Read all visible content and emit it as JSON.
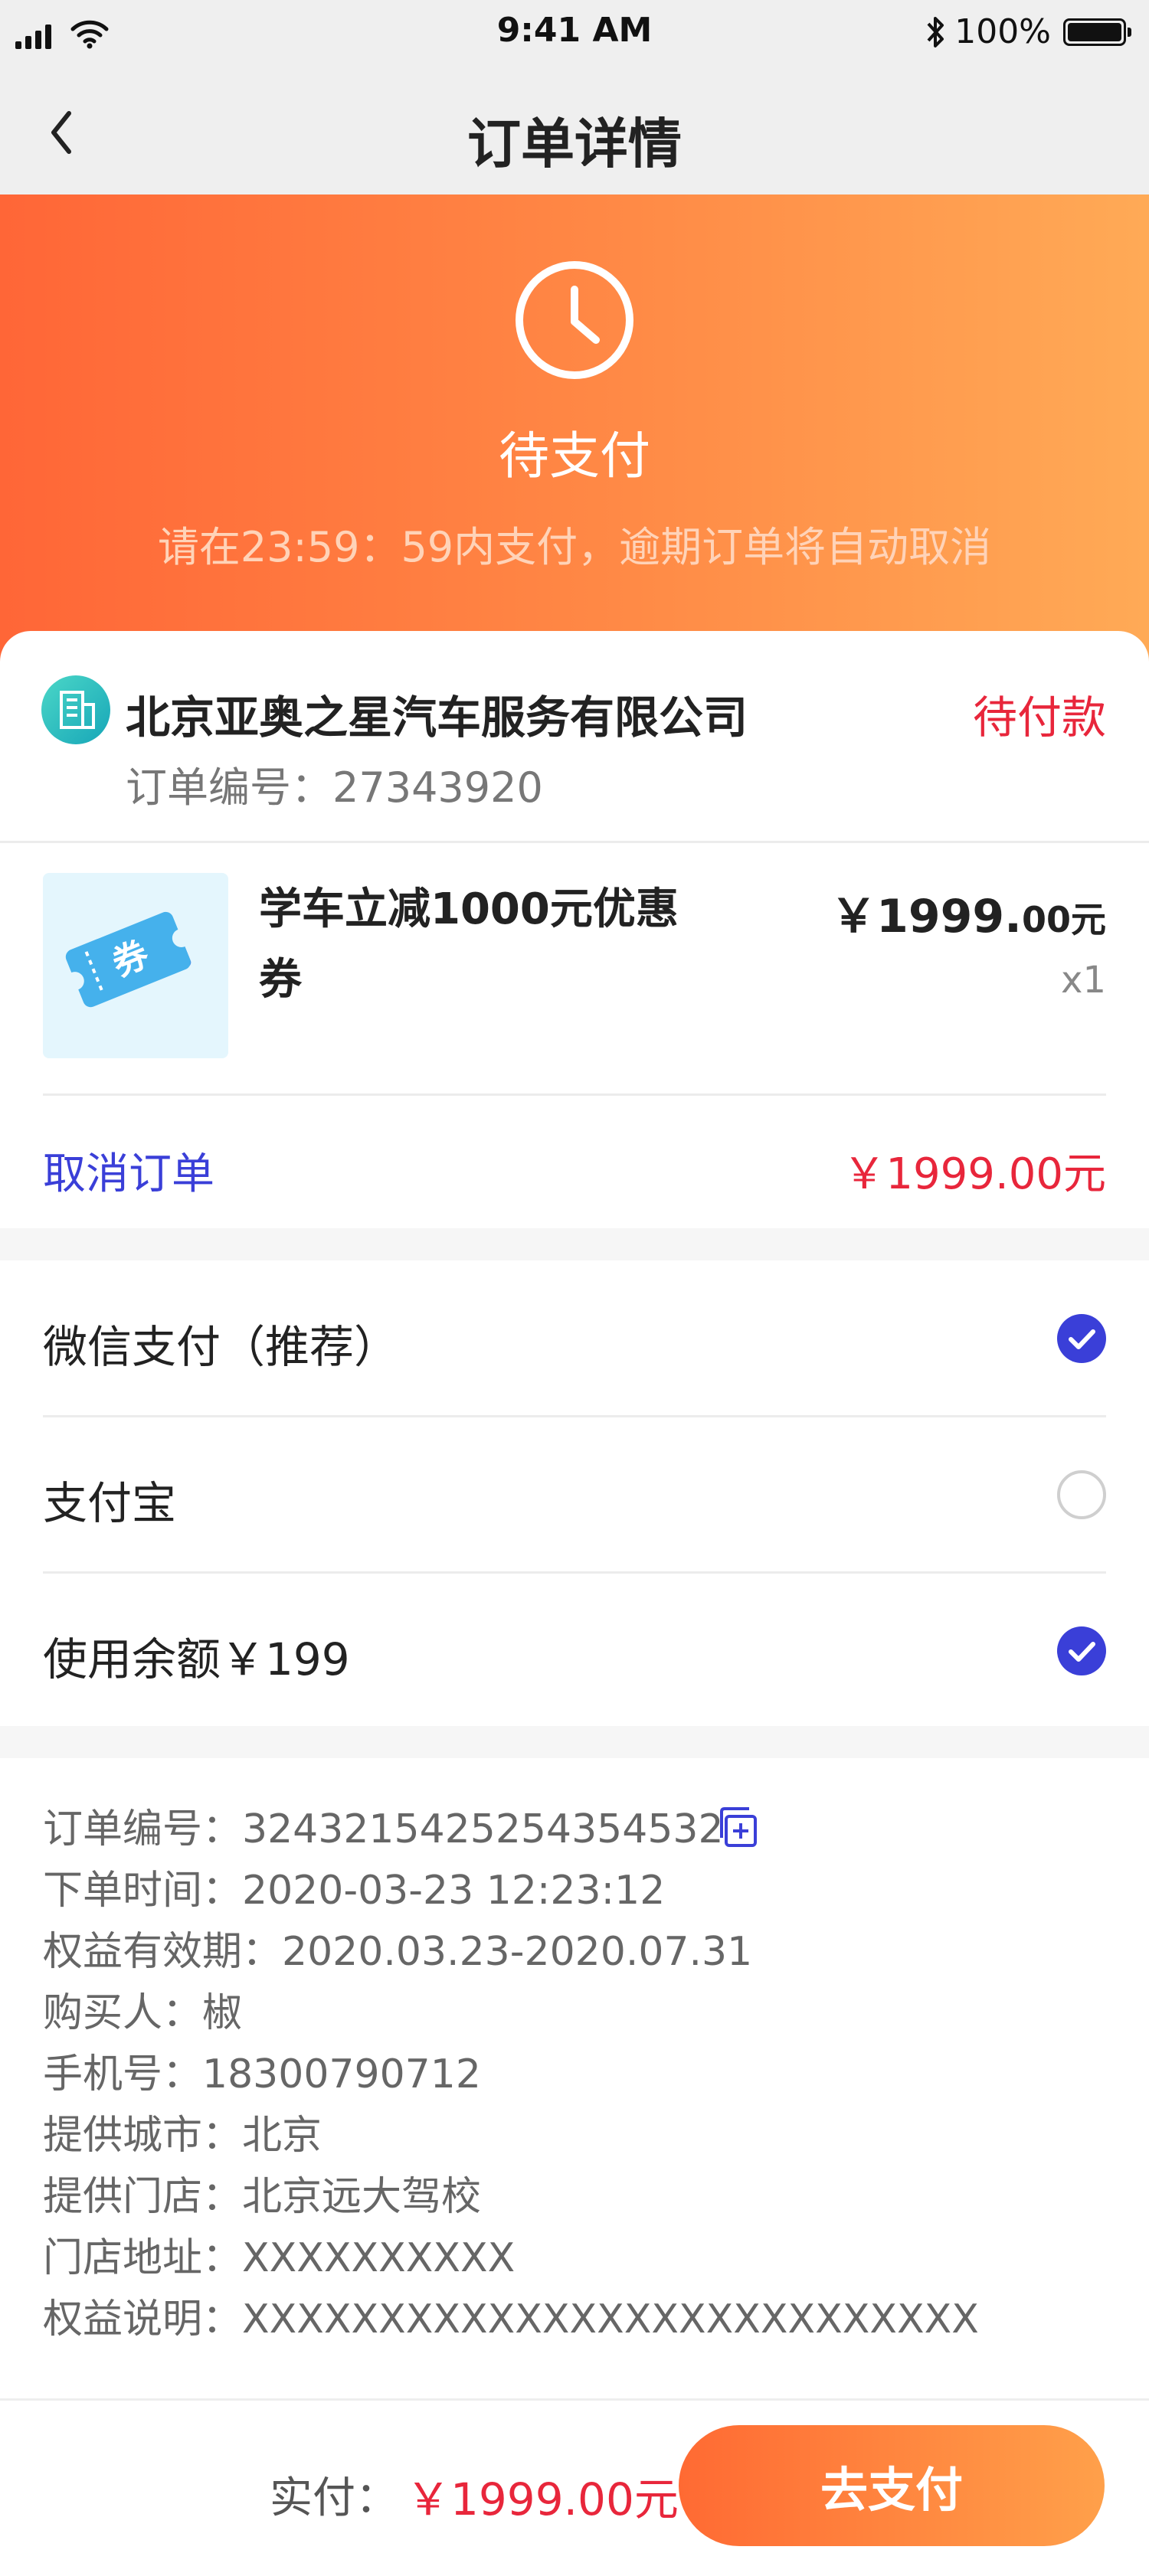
{
  "status_bar": {
    "time": "9:41 AM",
    "battery_text": "100%"
  },
  "nav": {
    "title": "订单详情"
  },
  "hero": {
    "status": "待支付",
    "countdown_text": "请在23:59：59内支付，逾期订单将自动取消"
  },
  "order": {
    "merchant": "北京亚奥之星汽车服务有限公司",
    "state": "待付款",
    "order_no_text": "订单编号：27343920",
    "product": {
      "title": "学车立减1000元优惠券",
      "thumb_glyph": "券",
      "price_main": "￥1999.",
      "price_small": "00元",
      "qty": "x1"
    },
    "cancel_label": "取消订单",
    "total": "￥1999.00元"
  },
  "payment": {
    "options": [
      {
        "label": "微信支付（推荐）",
        "checked": true
      },
      {
        "label": "支付宝",
        "checked": false
      },
      {
        "label": "使用余额￥199",
        "checked": true
      }
    ]
  },
  "info": {
    "lines": [
      "订单编号：3243215425254354532",
      "下单时间：2020-03-23 12:23:12",
      "权益有效期：2020.03.23-2020.07.31",
      "购买人：椒",
      "手机号：18300790712",
      "提供城市：北京",
      "提供门店：北京远大驾校",
      "门店地址：XXXXXXXXXX",
      "权益说明：XXXXXXXXXXXXXXXXXXXXXXXXXXX"
    ]
  },
  "bottom": {
    "label": "实付：",
    "amount": "￥1999.00元",
    "button": "去支付"
  },
  "colors": {
    "accent_red": "#e8263b",
    "link_blue": "#3a3fd8",
    "hero_gradient_start": "#ff6637",
    "hero_gradient_end": "#ffaa56"
  }
}
